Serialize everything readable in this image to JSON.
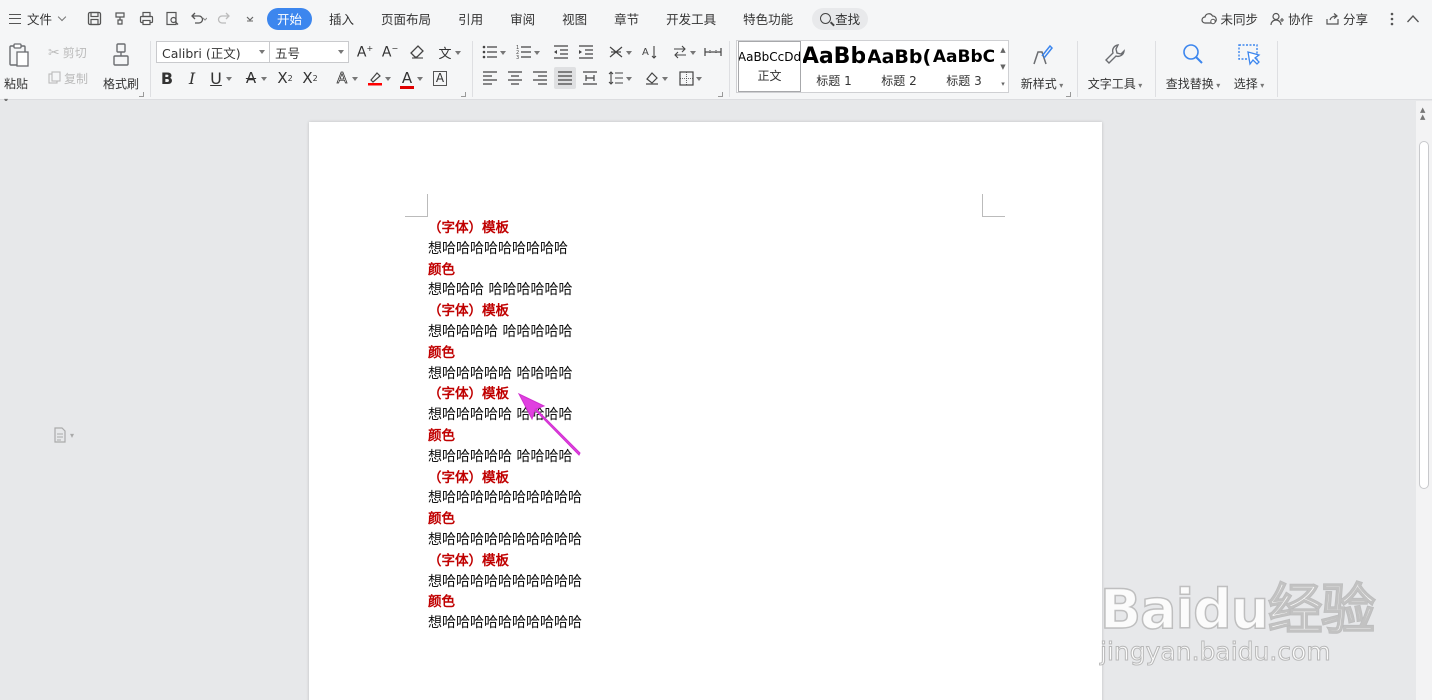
{
  "menubar": {
    "file_label": "文件",
    "tabs": [
      {
        "label": "开始",
        "active": true
      },
      {
        "label": "插入"
      },
      {
        "label": "页面布局"
      },
      {
        "label": "引用"
      },
      {
        "label": "审阅"
      },
      {
        "label": "视图"
      },
      {
        "label": "章节"
      },
      {
        "label": "开发工具"
      },
      {
        "label": "特色功能"
      }
    ],
    "search_label": "查找",
    "sync_label": "未同步",
    "collab_label": "协作",
    "share_label": "分享",
    "accent_color": "#3c86ee"
  },
  "ribbon": {
    "paste_label": "粘贴",
    "cut_label": "剪切",
    "copy_label": "复制",
    "format_painter_label": "格式刷",
    "font_name": "Calibri (正文)",
    "font_size": "五号",
    "styles": [
      {
        "sample": "AaBbCcDd",
        "name": "正文"
      },
      {
        "sample": "AaBb",
        "name": "标题 1"
      },
      {
        "sample": "AaBb(",
        "name": "标题 2"
      },
      {
        "sample": "AaBbC",
        "name": "标题 3"
      }
    ],
    "new_style_label": "新样式",
    "text_tools_label": "文字工具",
    "find_replace_label": "查找替换",
    "select_label": "选择"
  },
  "document": {
    "lines": [
      {
        "text": "（字体）模板",
        "style": "heading"
      },
      {
        "text": "想哈哈哈哈哈哈哈哈哈",
        "style": "body"
      },
      {
        "text": "颜色",
        "style": "heading"
      },
      {
        "text": "想哈哈哈 哈哈哈哈哈哈",
        "style": "body"
      },
      {
        "text": "（字体）模板",
        "style": "heading"
      },
      {
        "text": "想哈哈哈哈 哈哈哈哈哈",
        "style": "body"
      },
      {
        "text": "颜色",
        "style": "heading"
      },
      {
        "text": "想哈哈哈哈哈 哈哈哈哈",
        "style": "body"
      },
      {
        "text": "（字体）模板",
        "style": "heading"
      },
      {
        "text": "想哈哈哈哈哈 哈哈哈哈",
        "style": "body"
      },
      {
        "text": "颜色",
        "style": "heading"
      },
      {
        "text": "想哈哈哈哈哈 哈哈哈哈",
        "style": "body"
      },
      {
        "text": "（字体）模板",
        "style": "heading"
      },
      {
        "text": "想哈哈哈哈哈哈哈哈哈哈",
        "style": "body"
      },
      {
        "text": "颜色",
        "style": "heading"
      },
      {
        "text": "想哈哈哈哈哈哈哈哈哈哈",
        "style": "body"
      },
      {
        "text": "（字体）模板",
        "style": "heading"
      },
      {
        "text": "想哈哈哈哈哈哈哈哈哈哈",
        "style": "body"
      },
      {
        "text": "颜色",
        "style": "heading"
      },
      {
        "text": "想哈哈哈哈哈哈哈哈哈哈",
        "style": "body"
      }
    ],
    "heading_color": "#c00000",
    "annotation_arrow_color": "#e040e0"
  },
  "watermark": {
    "brand": "Baidu经验",
    "url": "jingyan.baidu.com"
  }
}
